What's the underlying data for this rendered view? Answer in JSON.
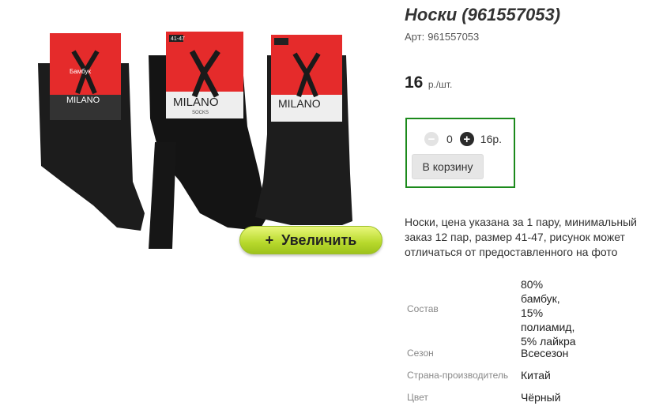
{
  "product": {
    "title": "Носки (961557053)",
    "sku_label": "Арт:",
    "sku_value": "961557053",
    "price_value": "16",
    "price_unit": "р./шт.",
    "image_alt": "Носки MILANO бамбук"
  },
  "buy_box": {
    "minus_icon": "minus-circle-icon",
    "plus_icon": "plus-circle-icon",
    "quantity": "0",
    "sum": "16р.",
    "cart_label": "В корзину"
  },
  "gallery": {
    "zoom_label": "Увеличить",
    "zoom_icon": "+",
    "label_brand": "MILANO",
    "label_sub": "SOCKS",
    "label_material": "Бамбук",
    "label_size": "41-47",
    "label_composition": "80% бамбук 15% полиамид 5% лайкра"
  },
  "description": "Носки, цена указана за 1 пару, минимальный заказ 12 пар, размер 41-47, рисунок может отличаться от предоставленного на фото",
  "specs": [
    {
      "label": "Состав",
      "value": "80% бамбук, 15% полиамид, 5% лайкра"
    },
    {
      "label": "Сезон",
      "value": "Всесезон"
    },
    {
      "label": "Страна-производитель",
      "value": "Китай"
    },
    {
      "label": "Цвет",
      "value": "Чёрный"
    }
  ],
  "colors": {
    "frame_green": "#1c8a1c",
    "zoom_lime": "#b7d92c",
    "label_red": "#e52b2b",
    "sock_black": "#1a1a1a"
  }
}
